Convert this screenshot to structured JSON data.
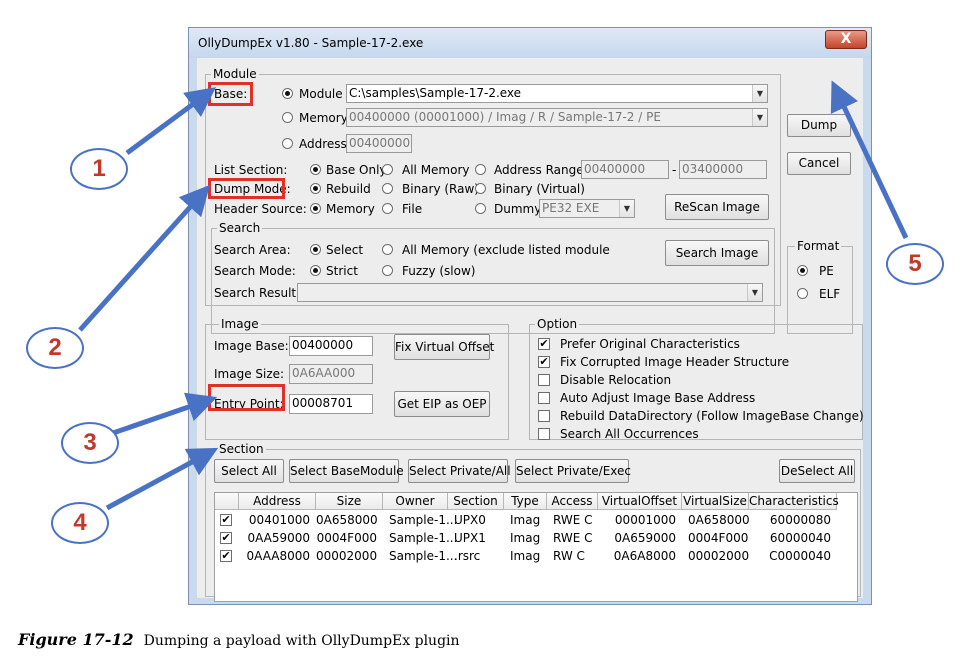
{
  "window": {
    "title": "OllyDumpEx v1.80 - Sample-17-2.exe",
    "close_glyph": "X"
  },
  "module": {
    "group_label": "Module",
    "base_label": "Base:",
    "module_radio": "Module",
    "module_path": "C:\\samples\\Sample-17-2.exe",
    "memory_radio": "Memory",
    "memory_value": "00400000 (00001000) / Imag / R    / Sample-17-2 / PE",
    "address_radio": "Address",
    "address_value": "00400000",
    "list_section_label": "List Section:",
    "base_only": "Base Only",
    "all_memory": "All Memory",
    "address_range": "Address Range",
    "range_from": "00400000",
    "range_dash": "-",
    "range_to": "03400000",
    "dump_mode_label": "Dump Mode:",
    "rebuild": "Rebuild",
    "binary_raw": "Binary (Raw)",
    "binary_virtual": "Binary (Virtual)",
    "header_source_label": "Header Source:",
    "hs_memory": "Memory",
    "hs_file": "File",
    "hs_dummy": "Dummy",
    "dummy_value": "PE32 EXE",
    "rescan_button": "ReScan Image"
  },
  "search": {
    "group_label": "Search",
    "area_label": "Search Area:",
    "select": "Select",
    "all_memory_excl": "All Memory (exclude listed module",
    "mode_label": "Search Mode:",
    "strict": "Strict",
    "fuzzy": "Fuzzy (slow)",
    "result_label": "Search Result:",
    "search_button": "Search Image"
  },
  "format": {
    "group_label": "Format",
    "pe": "PE",
    "elf": "ELF"
  },
  "buttons": {
    "dump": "Dump",
    "cancel": "Cancel"
  },
  "image": {
    "group_label": "Image",
    "base_label": "Image Base:",
    "base_value": "00400000",
    "fix_button": "Fix Virtual Offset",
    "size_label": "Image Size:",
    "size_value": "0A6AA000",
    "entry_label": "Entry Point:",
    "entry_value": "00008701",
    "eip_button": "Get EIP as OEP"
  },
  "option": {
    "group_label": "Option",
    "items": [
      {
        "label": "Prefer Original Characteristics",
        "checked": true
      },
      {
        "label": "Fix Corrupted Image Header Structure",
        "checked": true
      },
      {
        "label": "Disable Relocation",
        "checked": false
      },
      {
        "label": "Auto Adjust Image Base Address",
        "checked": false
      },
      {
        "label": "Rebuild DataDirectory (Follow ImageBase Change)",
        "checked": false
      },
      {
        "label": "Search All Occurrences",
        "checked": false
      }
    ]
  },
  "section": {
    "group_label": "Section",
    "select_all": "Select All",
    "select_base": "Select BaseModule",
    "select_private_all": "Select Private/All",
    "select_private_exec": "Select Private/Exec",
    "deselect_all": "DeSelect All",
    "columns": [
      "Address",
      "Size",
      "Owner",
      "Section",
      "Type",
      "Access",
      "VirtualOffset",
      "VirtualSize",
      "Characteristics"
    ],
    "rows": [
      [
        "00401000",
        "0A658000",
        "Sample-1...",
        "UPX0",
        "Imag",
        "RWE C",
        "00001000",
        "0A658000",
        "60000080"
      ],
      [
        "0AA59000",
        "0004F000",
        "Sample-1...",
        "UPX1",
        "Imag",
        "RWE C",
        "0A659000",
        "0004F000",
        "60000040"
      ],
      [
        "0AAA8000",
        "00002000",
        "Sample-1...",
        ".rsrc",
        "Imag",
        "RW  C",
        "0A6A8000",
        "00002000",
        "C0000040"
      ]
    ]
  },
  "callouts": [
    "1",
    "2",
    "3",
    "4",
    "5"
  ],
  "caption": {
    "label": "Figure 17-12",
    "text": "Dumping a payload with OllyDumpEx plugin"
  },
  "colors": {
    "highlight": "#e0302a",
    "arrow": "#4a72c4",
    "callout_text": "#c0392b"
  }
}
